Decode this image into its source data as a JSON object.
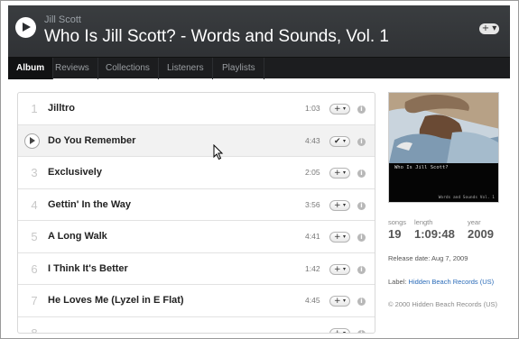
{
  "header": {
    "artist": "Jill Scott",
    "title": "Who Is Jill Scott? - Words and Sounds, Vol. 1",
    "add_label": "+ ▾"
  },
  "tabs": [
    {
      "label": "Album",
      "active": true
    },
    {
      "label": "Reviews",
      "active": false
    },
    {
      "label": "Collections",
      "active": false
    },
    {
      "label": "Listeners",
      "active": false
    },
    {
      "label": "Playlists",
      "active": false
    }
  ],
  "tracks": [
    {
      "num": "1",
      "name": "Jilltro",
      "length": "1:03"
    },
    {
      "num": "2",
      "name": "Do You Remember",
      "length": "4:43",
      "selected": true
    },
    {
      "num": "3",
      "name": "Exclusively",
      "length": "2:05"
    },
    {
      "num": "4",
      "name": "Gettin' In the Way",
      "length": "3:56"
    },
    {
      "num": "5",
      "name": "A Long Walk",
      "length": "4:41"
    },
    {
      "num": "6",
      "name": "I Think It's Better",
      "length": "1:42"
    },
    {
      "num": "7",
      "name": "He Loves Me (Lyzel in E Flat)",
      "length": "4:45"
    },
    {
      "num": "8",
      "name": "",
      "length": ""
    }
  ],
  "track_add": {
    "plus": "+",
    "arrow": "▾",
    "check": "✔",
    "info": "i"
  },
  "cover": {
    "line1": "Who Is Jill Scott?",
    "line2": "Words and Sounds Vol. 1"
  },
  "stats": {
    "songs_label": "songs",
    "songs_value": "19",
    "length_label": "length",
    "length_value": "1:09:48",
    "year_label": "year",
    "year_value": "2009"
  },
  "release": "Release date: Aug 7, 2009",
  "label_prefix": "Label: ",
  "label_link": "Hidden Beach Records (US)",
  "copyright": "© 2000 Hidden Beach Records (US)",
  "colors": {
    "header_bg": "#2b2d30",
    "link": "#2a6bb8"
  }
}
